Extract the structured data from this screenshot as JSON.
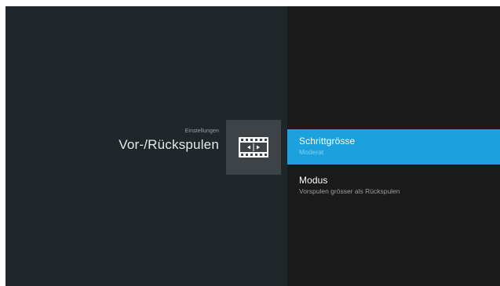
{
  "header": {
    "breadcrumb": "Einstellungen",
    "title": "Vor-/Rückspulen",
    "icon": "film-seek-icon"
  },
  "menu": {
    "items": [
      {
        "title": "Schrittgrösse",
        "subtitle": "Moderat",
        "selected": true
      },
      {
        "title": "Modus",
        "subtitle": "Vorspulen grösser als Rückspulen",
        "selected": false
      }
    ]
  },
  "colors": {
    "left_background": "#20272b",
    "right_background": "#1a1a1a",
    "icon_tile": "#3d4347",
    "accent": "#1ba2dd"
  }
}
